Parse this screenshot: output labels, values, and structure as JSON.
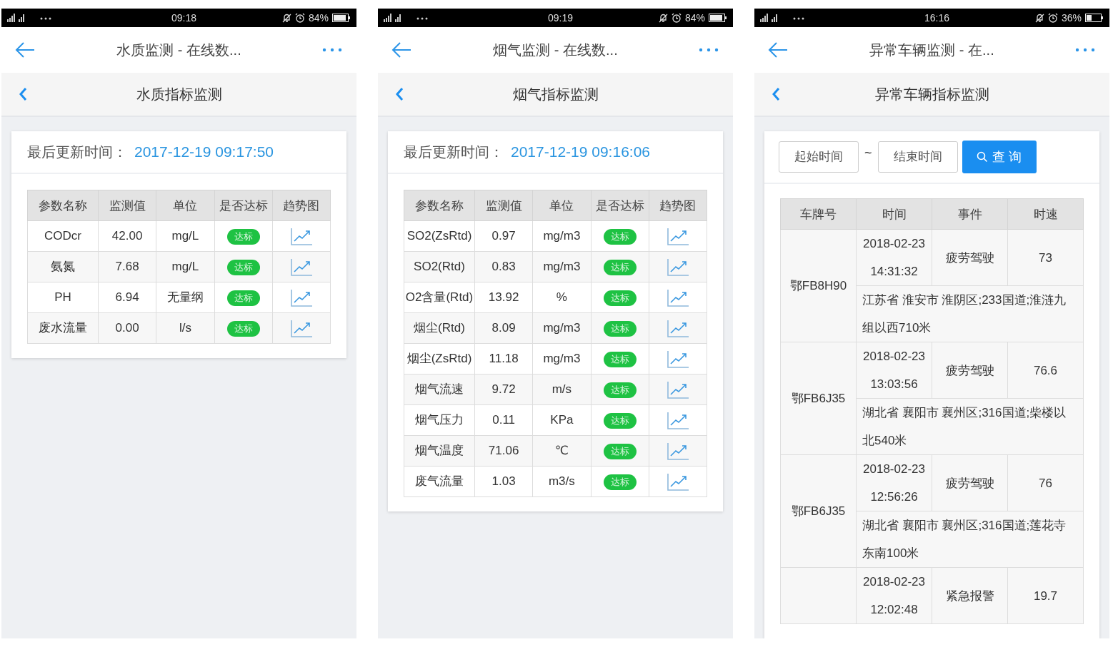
{
  "phones": [
    {
      "kind": "indicators",
      "status_bar": {
        "time": "09:18",
        "battery": "84%"
      },
      "title": "水质监测 - 在线数...",
      "subtitle": "水质指标监测",
      "updated_label": "最后更新时间：",
      "updated_time": "2017-12-19 09:17:50",
      "table": {
        "columns": [
          "参数名称",
          "监测值",
          "单位",
          "是否达标",
          "趋势图"
        ],
        "rows": [
          {
            "name": "CODcr",
            "value": "42.00",
            "unit": "mg/L",
            "status": "达标"
          },
          {
            "name": "氨氮",
            "value": "7.68",
            "unit": "mg/L",
            "status": "达标"
          },
          {
            "name": "PH",
            "value": "6.94",
            "unit": "无量纲",
            "status": "达标"
          },
          {
            "name": "废水流量",
            "value": "0.00",
            "unit": "l/s",
            "status": "达标"
          }
        ]
      }
    },
    {
      "kind": "indicators",
      "status_bar": {
        "time": "09:19",
        "battery": "84%"
      },
      "title": "烟气监测 - 在线数...",
      "subtitle": "烟气指标监测",
      "updated_label": "最后更新时间：",
      "updated_time": "2017-12-19 09:16:06",
      "table": {
        "columns": [
          "参数名称",
          "监测值",
          "单位",
          "是否达标",
          "趋势图"
        ],
        "rows": [
          {
            "name": "SO2(ZsRtd)",
            "value": "0.97",
            "unit": "mg/m3",
            "status": "达标"
          },
          {
            "name": "SO2(Rtd)",
            "value": "0.83",
            "unit": "mg/m3",
            "status": "达标"
          },
          {
            "name": "O2含量(Rtd)",
            "value": "13.92",
            "unit": "%",
            "status": "达标"
          },
          {
            "name": "烟尘(Rtd)",
            "value": "8.09",
            "unit": "mg/m3",
            "status": "达标"
          },
          {
            "name": "烟尘(ZsRtd)",
            "value": "11.18",
            "unit": "mg/m3",
            "status": "达标"
          },
          {
            "name": "烟气流速",
            "value": "9.72",
            "unit": "m/s",
            "status": "达标"
          },
          {
            "name": "烟气压力",
            "value": "0.11",
            "unit": "KPa",
            "status": "达标"
          },
          {
            "name": "烟气温度",
            "value": "71.06",
            "unit": "℃",
            "status": "达标"
          },
          {
            "name": "废气流量",
            "value": "1.03",
            "unit": "m3/s",
            "status": "达标"
          }
        ]
      }
    },
    {
      "kind": "vehicles",
      "status_bar": {
        "time": "16:16",
        "battery": "36%"
      },
      "title": "异常车辆监测 - 在...",
      "subtitle": "异常车辆指标监测",
      "start_placeholder": "起始时间",
      "separator": "~",
      "end_placeholder": "结束时间",
      "query_button": "查 询",
      "table": {
        "columns": [
          "车牌号",
          "时间",
          "事件",
          "时速"
        ],
        "rows": [
          {
            "plate": "鄂FB8H90",
            "time": "2018-02-23 14:31:32",
            "event": "疲劳驾驶",
            "speed": "73",
            "address": "江苏省 淮安市 淮阴区;233国道;淮涟九组以西710米"
          },
          {
            "plate": "鄂FB6J35",
            "time": "2018-02-23 13:03:56",
            "event": "疲劳驾驶",
            "speed": "76.6",
            "address": "湖北省 襄阳市 襄州区;316国道;柴楼以北540米"
          },
          {
            "plate": "鄂FB6J35",
            "time": "2018-02-23 12:56:26",
            "event": "疲劳驾驶",
            "speed": "76",
            "address": "湖北省 襄阳市 襄州区;316国道;莲花寺东南100米"
          },
          {
            "time": "2018-02-23 12:02:48",
            "event": "紧急报警",
            "speed": "19.7"
          }
        ]
      }
    }
  ]
}
